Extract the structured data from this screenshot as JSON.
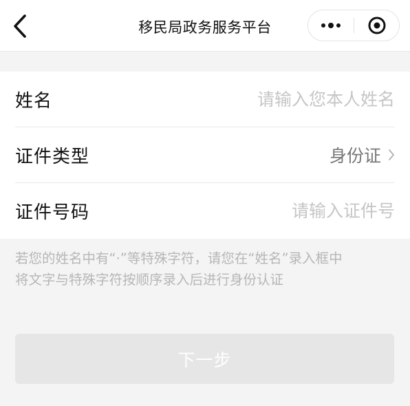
{
  "header": {
    "title": "移民局政务服务平台",
    "back_icon": "chevron-left-icon",
    "more_icon": "more-dots-icon",
    "close_icon": "target-circle-icon"
  },
  "form": {
    "name": {
      "label": "姓名",
      "placeholder": "请输入您本人姓名",
      "value": ""
    },
    "id_type": {
      "label": "证件类型",
      "value": "身份证",
      "chevron_icon": "chevron-right-icon"
    },
    "id_number": {
      "label": "证件号码",
      "placeholder": "请输入证件号",
      "value": ""
    }
  },
  "note": {
    "line1": "若您的姓名中有“·”等特殊字符，请您在“姓名”录入框中",
    "line2": "将文字与特殊字符按顺序录入后进行身份认证"
  },
  "actions": {
    "next_label": "下一步"
  },
  "colors": {
    "background": "#f4f4f4",
    "card": "#ffffff",
    "placeholder": "#c6c6c6",
    "disabled_button": "#e6e6e6"
  }
}
